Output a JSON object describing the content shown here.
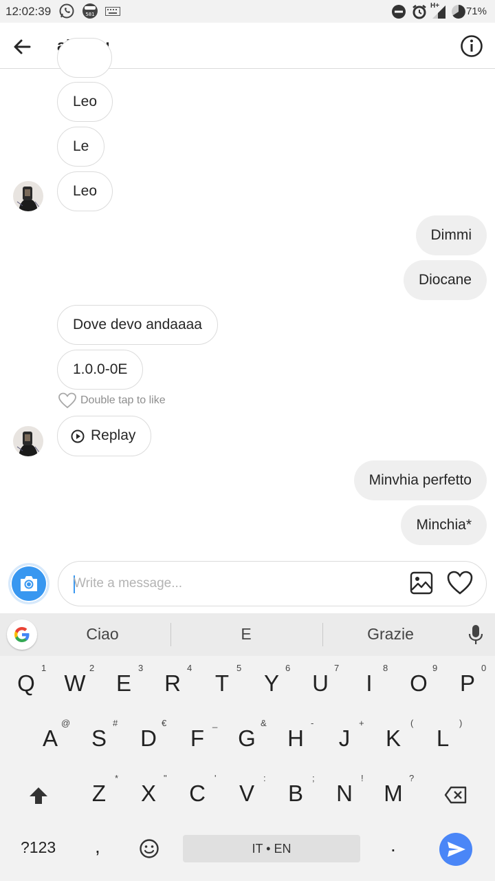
{
  "status_bar": {
    "time": "12:02:39",
    "notif_badge": "581",
    "network": "H+",
    "battery": "71%",
    "icons": [
      "whatsapp-icon",
      "notification-badge-icon",
      "keyboard-icon",
      "dnd-icon",
      "alarm-icon",
      "signal-icon",
      "battery-icon"
    ]
  },
  "header": {
    "title": "ale_tru",
    "back_icon": "arrow-left-icon",
    "info_icon": "info-icon"
  },
  "messages": [
    {
      "from": "them",
      "text": "Leo"
    },
    {
      "from": "them",
      "text": "Le"
    },
    {
      "from": "them",
      "text": "Leo"
    },
    {
      "from": "me",
      "text": "Dimmi"
    },
    {
      "from": "me",
      "text": "Diocane"
    },
    {
      "from": "them",
      "text": "Dove devo andaaaa"
    },
    {
      "from": "them",
      "text": "1.0.0-0E"
    },
    {
      "from": "them",
      "text": "Replay",
      "kind": "replay"
    },
    {
      "from": "me",
      "text": "Minvhia perfetto"
    },
    {
      "from": "me",
      "text": "Minchia*"
    }
  ],
  "like_hint": "Double tap to like",
  "compose": {
    "placeholder": "Write a message...",
    "value": ""
  },
  "keyboard": {
    "suggestions": [
      "Ciao",
      "E",
      "Grazie"
    ],
    "row1": {
      "keys": [
        "Q",
        "W",
        "E",
        "R",
        "T",
        "Y",
        "U",
        "I",
        "O",
        "P"
      ],
      "hints": [
        "1",
        "2",
        "3",
        "4",
        "5",
        "6",
        "7",
        "8",
        "9",
        "0"
      ]
    },
    "row2": {
      "keys": [
        "A",
        "S",
        "D",
        "F",
        "G",
        "H",
        "J",
        "K",
        "L"
      ],
      "hints": [
        "@",
        "#",
        "€",
        "_",
        "&",
        "-",
        "+",
        "(",
        ")"
      ]
    },
    "row3": {
      "keys": [
        "Z",
        "X",
        "C",
        "V",
        "B",
        "N",
        "M"
      ],
      "hints": [
        "*",
        "\"",
        "'",
        ":",
        ";",
        "!",
        "?"
      ]
    },
    "symbols_key": "?123",
    "comma": ",",
    "space_label": "IT • EN",
    "period": "."
  },
  "colors": {
    "accent": "#3897f0",
    "send": "#4a86f7",
    "bubble_out": "#efefef",
    "border": "#dbdbdb"
  }
}
